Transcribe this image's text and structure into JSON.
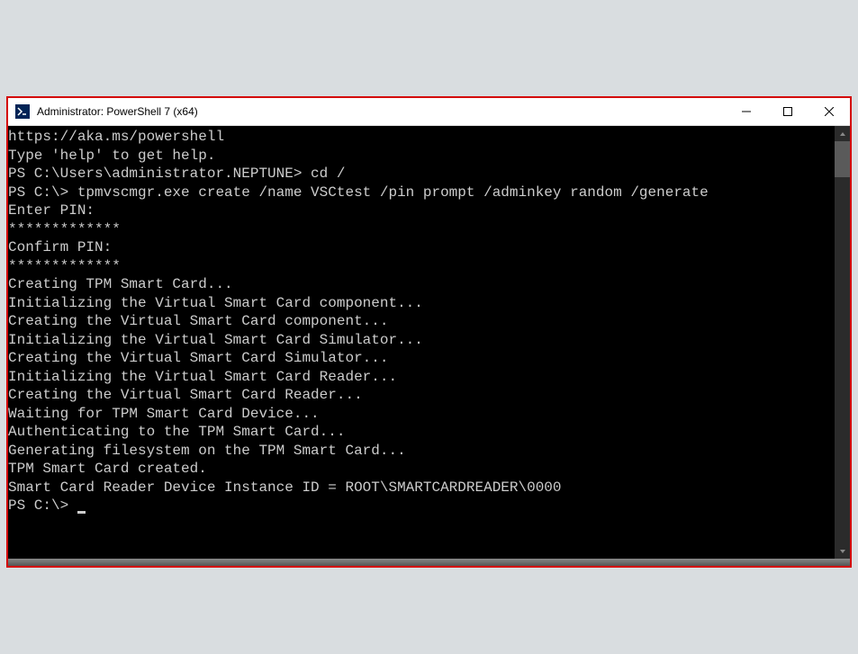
{
  "window": {
    "title": "Administrator: PowerShell 7 (x64)"
  },
  "terminal": {
    "lines": [
      "https://aka.ms/powershell",
      "Type 'help' to get help.",
      "",
      "PS C:\\Users\\administrator.NEPTUNE> cd /",
      "PS C:\\> tpmvscmgr.exe create /name VSCtest /pin prompt /adminkey random /generate",
      "Enter PIN:",
      "*************",
      "Confirm PIN:",
      "*************",
      "Creating TPM Smart Card...",
      "Initializing the Virtual Smart Card component...",
      "Creating the Virtual Smart Card component...",
      "Initializing the Virtual Smart Card Simulator...",
      "Creating the Virtual Smart Card Simulator...",
      "Initializing the Virtual Smart Card Reader...",
      "Creating the Virtual Smart Card Reader...",
      "Waiting for TPM Smart Card Device...",
      "Authenticating to the TPM Smart Card...",
      "Generating filesystem on the TPM Smart Card...",
      "TPM Smart Card created.",
      "Smart Card Reader Device Instance ID = ROOT\\SMARTCARDREADER\\0000"
    ],
    "prompt": "PS C:\\> "
  }
}
